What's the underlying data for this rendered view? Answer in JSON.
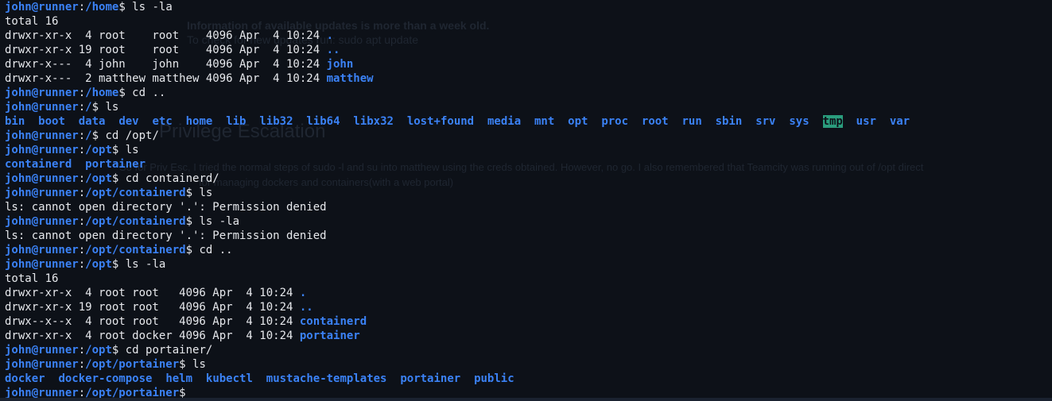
{
  "background_text": {
    "line1": "Information of available updates is more than a week old.",
    "line2": "To check for new updates run: sudo apt update",
    "heading": "Privilege Escalation",
    "para1": "So for Priv Esc, I tried the normal steps of sudo -l and su into matthew using the creds obtained. However, no go. I also remembered that Teamcity was running out of /opt direct",
    "para2": "for managing dockers and containers(with a web portal)"
  },
  "terminal": {
    "prompt_user": "john@runner",
    "lines": [
      {
        "type": "prompt",
        "path": "/home",
        "cmd": "ls -la"
      },
      {
        "type": "out",
        "text": "total 16"
      },
      {
        "type": "entry",
        "prefix": "drwxr-xr-x  4 root    root    4096 Apr  4 10:24 ",
        "name": "."
      },
      {
        "type": "entry",
        "prefix": "drwxr-xr-x 19 root    root    4096 Apr  4 10:24 ",
        "name": ".."
      },
      {
        "type": "entry",
        "prefix": "drwxr-x---  4 john    john    4096 Apr  4 10:24 ",
        "name": "john"
      },
      {
        "type": "entry",
        "prefix": "drwxr-x---  2 matthew matthew 4096 Apr  4 10:24 ",
        "name": "matthew"
      },
      {
        "type": "prompt",
        "path": "/home",
        "cmd": "cd .."
      },
      {
        "type": "prompt",
        "path": "/",
        "cmd": "ls"
      },
      {
        "type": "listing",
        "items": [
          "bin",
          "boot",
          "data",
          "dev",
          "etc",
          "home",
          "lib",
          "lib32",
          "lib64",
          "libx32",
          "lost+found",
          "media",
          "mnt",
          "opt",
          "proc",
          "root",
          "run",
          "sbin",
          "srv",
          "sys",
          "tmp",
          "usr",
          "var"
        ],
        "highlight": "tmp"
      },
      {
        "type": "prompt",
        "path": "/",
        "cmd": "cd /opt/"
      },
      {
        "type": "prompt",
        "path": "/opt",
        "cmd": "ls"
      },
      {
        "type": "listing",
        "items": [
          "containerd",
          "portainer"
        ]
      },
      {
        "type": "prompt",
        "path": "/opt",
        "cmd": "cd containerd/"
      },
      {
        "type": "prompt",
        "path": "/opt/containerd",
        "cmd": "ls"
      },
      {
        "type": "out",
        "text": "ls: cannot open directory '.': Permission denied"
      },
      {
        "type": "prompt",
        "path": "/opt/containerd",
        "cmd": "ls -la"
      },
      {
        "type": "out",
        "text": "ls: cannot open directory '.': Permission denied"
      },
      {
        "type": "prompt",
        "path": "/opt/containerd",
        "cmd": "cd .."
      },
      {
        "type": "prompt",
        "path": "/opt",
        "cmd": "ls -la"
      },
      {
        "type": "out",
        "text": "total 16"
      },
      {
        "type": "entry",
        "prefix": "drwxr-xr-x  4 root root   4096 Apr  4 10:24 ",
        "name": "."
      },
      {
        "type": "entry",
        "prefix": "drwxr-xr-x 19 root root   4096 Apr  4 10:24 ",
        "name": ".."
      },
      {
        "type": "entry",
        "prefix": "drwx--x--x  4 root root   4096 Apr  4 10:24 ",
        "name": "containerd"
      },
      {
        "type": "entry",
        "prefix": "drwxr-xr-x  4 root docker 4096 Apr  4 10:24 ",
        "name": "portainer"
      },
      {
        "type": "prompt",
        "path": "/opt",
        "cmd": "cd portainer/"
      },
      {
        "type": "prompt",
        "path": "/opt/portainer",
        "cmd": "ls"
      },
      {
        "type": "listing",
        "items": [
          "docker",
          "docker-compose",
          "helm",
          "kubectl",
          "mustache-templates",
          "portainer",
          "public"
        ]
      },
      {
        "type": "prompt",
        "path": "/opt/portainer",
        "cmd": ""
      }
    ]
  },
  "colors": {
    "background": "#0d1118",
    "text": "#e6e8ec",
    "prompt": "#3b82f6",
    "directory": "#3b82f6",
    "highlight_bg": "#2a9d7d"
  }
}
